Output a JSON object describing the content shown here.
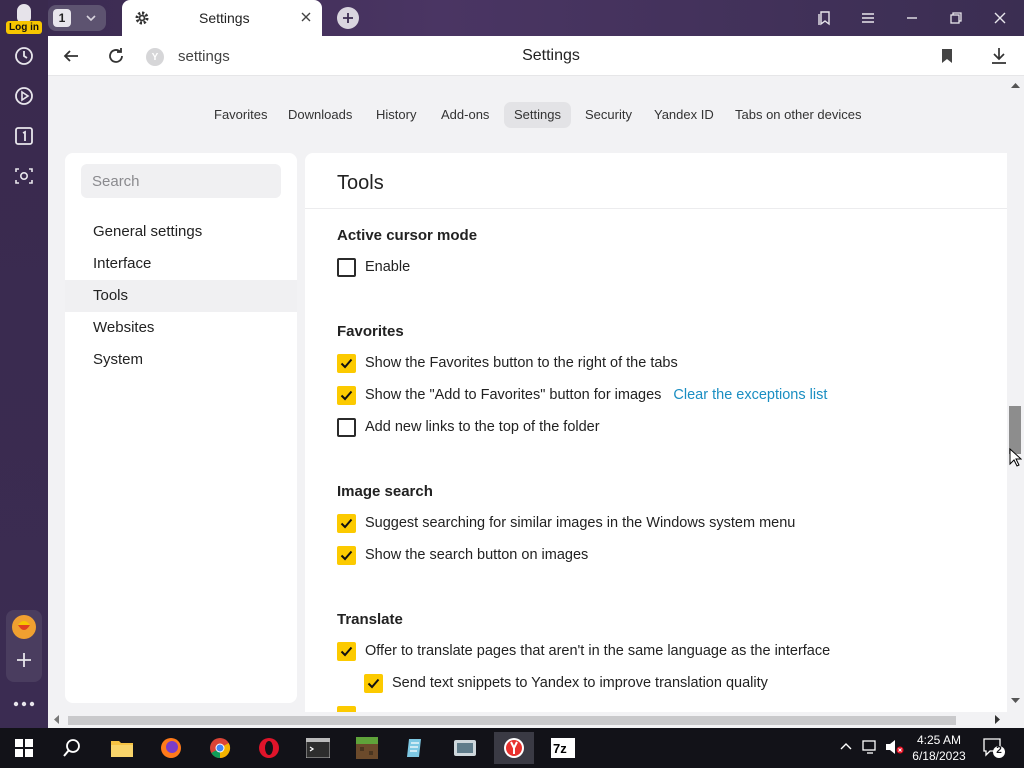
{
  "sidebar": {
    "login_label": "Log in",
    "colors": {
      "background": "#3a2a4e",
      "badge": "#f7c600"
    }
  },
  "tabbar": {
    "tab_count": "1",
    "active_tab_title": "Settings"
  },
  "addressbar": {
    "url_text": "settings",
    "page_title": "Settings"
  },
  "nav_tabs": [
    {
      "label": "Favorites"
    },
    {
      "label": "Downloads"
    },
    {
      "label": "History"
    },
    {
      "label": "Add-ons"
    },
    {
      "label": "Settings",
      "active": true
    },
    {
      "label": "Security"
    },
    {
      "label": "Yandex ID"
    },
    {
      "label": "Tabs on other devices"
    }
  ],
  "settings_menu": {
    "search_placeholder": "Search",
    "items": [
      {
        "label": "General settings"
      },
      {
        "label": "Interface"
      },
      {
        "label": "Tools",
        "active": true
      },
      {
        "label": "Websites"
      },
      {
        "label": "System"
      }
    ]
  },
  "content": {
    "title": "Tools",
    "sections": [
      {
        "title": "Active cursor mode",
        "options": [
          {
            "label": "Enable",
            "checked": false
          }
        ]
      },
      {
        "title": "Favorites",
        "options": [
          {
            "label": "Show the Favorites button to the right of the tabs",
            "checked": true
          },
          {
            "label": "Show the \"Add to Favorites\" button for images",
            "checked": true,
            "link": "Clear the exceptions list"
          },
          {
            "label": "Add new links to the top of the folder",
            "checked": false
          }
        ]
      },
      {
        "title": "Image search",
        "options": [
          {
            "label": "Suggest searching for similar images in the Windows system menu",
            "checked": true
          },
          {
            "label": "Show the search button on images",
            "checked": true
          }
        ]
      },
      {
        "title": "Translate",
        "options": [
          {
            "label": "Offer to translate pages that aren't in the same language as the interface",
            "checked": true
          },
          {
            "label": "Send text snippets to Yandex to improve translation quality",
            "checked": true,
            "sub": true
          }
        ]
      }
    ],
    "colors": {
      "checkbox_on": "#fcca00",
      "link": "#1a8ec2"
    }
  },
  "taskbar": {
    "time": "4:25 AM",
    "date": "6/18/2023",
    "notification_count": "2"
  }
}
